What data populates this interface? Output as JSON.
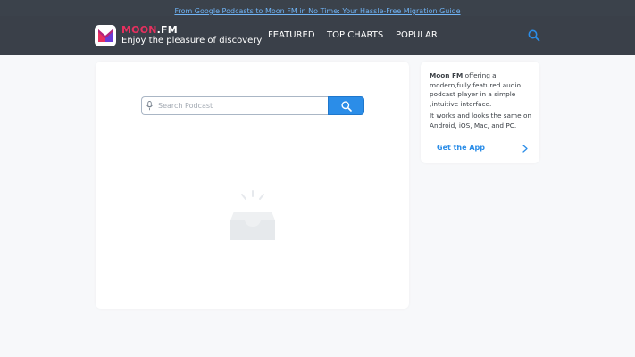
{
  "promo": {
    "link_text": "From Google Podcasts to Moon FM in No Time: Your Hassle-Free Migration Guide"
  },
  "brand": {
    "name_part1": "MOON",
    "name_part2": ".FM",
    "tagline": "Enjoy the pleasure of discovery"
  },
  "nav": {
    "featured": "FEATURED",
    "top_charts": "TOP CHARTS",
    "popular": "POPULAR"
  },
  "search": {
    "placeholder": "Search Podcast"
  },
  "sidebar": {
    "brand_bold": "Moon FM",
    "description": " offering a modern,fully featured audio podcast player in a simple ,intuitive interface.",
    "platforms": "It works and looks the same on Android, iOS, Mac, and PC.",
    "cta": "Get the App"
  },
  "colors": {
    "header_bg": "#3a4049",
    "accent": "#2b8de8",
    "brand_red": "#e8305f"
  }
}
